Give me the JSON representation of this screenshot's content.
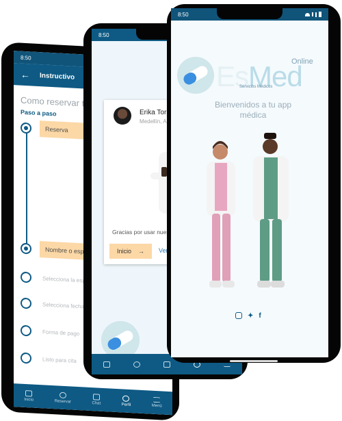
{
  "status_time": "8:50",
  "phone1": {
    "header_title": "Instructivo",
    "page_title": "Como reservar tu cita",
    "subtitle": "Paso a paso",
    "steps": [
      {
        "label": "Reserva",
        "state": "active"
      },
      {
        "label": "Nombre o especialista",
        "state": "active"
      },
      {
        "label": "Selecciona la especialidad",
        "state": "pending"
      },
      {
        "label": "Selecciona fecha",
        "state": "pending"
      },
      {
        "label": "Forma de pago",
        "state": "pending"
      },
      {
        "label": "Listo para cita",
        "state": "pending"
      }
    ],
    "nav": [
      "Inicio",
      "Reservar",
      "Chat",
      "Perfil",
      "Menú"
    ]
  },
  "phone2": {
    "user_name": "Erika Torres",
    "user_location": "Medellín, Antioquia",
    "thanks_text": "Gracias por usar nuestro servicio",
    "start_button": "Inicio",
    "see_link": "Ver presentación"
  },
  "phone3": {
    "logo_main": "Med",
    "logo_prefix": "Es",
    "logo_online": "Online",
    "logo_tagline": "Servicios Médicos",
    "welcome_line1": "Bienvenidos a tu app",
    "welcome_line2": "médica",
    "social_icons": [
      "instagram-icon",
      "twitter-icon",
      "facebook-icon"
    ]
  },
  "colors": {
    "primary": "#0e5a84",
    "accent": "#fcd8a6",
    "muted": "#9aaeb9"
  }
}
